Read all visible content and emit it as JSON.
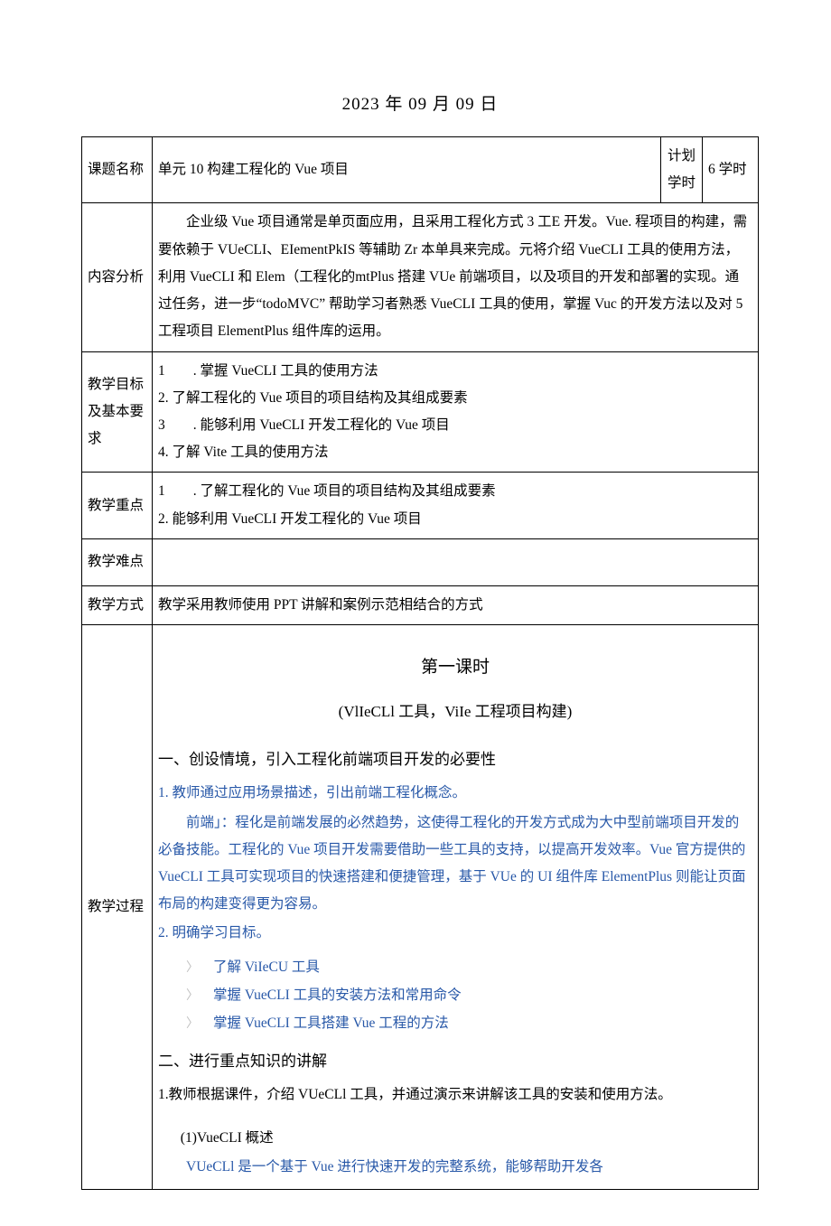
{
  "date": "2023 年 09 月 09 日",
  "rows": {
    "topic_label": "课题名称",
    "topic_value": "单元 10 构建工程化的 Vue 项目",
    "plan_label": "计划学时",
    "plan_value": "6 学时",
    "content_label": "内容分析",
    "content_value": "　　企业级 Vue 项目通常是单页面应用，且采用工程化方式 3 工E 开发。Vue. 程项目的构建，需要依赖于 VUeCLI、EIementPkIS 等辅助 Zr 本单具来完成。元将介绍 VueCLI 工具的使用方法，利用 VueCLI 和 Elem（工程化的mtPlus 搭建 VUe 前端项目，以及项目的开发和部署的实现。通过任务，进一步“todoMVC” 帮助学习者熟悉 VueCLI 工具的使用，掌握 Vuc 的开发方法以及对 5 工程项目 ElementPlus 组件库的运用。",
    "goals_label": "教学目标及基本要求",
    "goals": [
      "1　　. 掌握 VueCLI 工具的使用方法",
      "2. 了解工程化的 Vue 项目的项目结构及其组成要素",
      "3　　. 能够利用 VueCLI 开发工程化的 Vue 项目",
      "4. 了解 Vite 工具的使用方法"
    ],
    "focus_label": "教学重点",
    "focus": [
      "1　　. 了解工程化的 Vue 项目的项目结构及其组成要素",
      "2. 能够利用 VueCLI 开发工程化的 Vue 项目"
    ],
    "difficulty_label": "教学难点",
    "difficulty_value": "",
    "method_label": "教学方式",
    "method_value": "教学采用教师使用 PPT 讲解和案例示范相结合的方式",
    "process_label": "教学过程"
  },
  "process": {
    "lesson_title": "第一课时",
    "lesson_subtitle": "(VlIeCLl 工具，ViIe 工程项目构建)",
    "sec1_title": "一、创设情境，引入工程化前端项目开发的必要性",
    "sec1_item1": "1. 教师通过应用场景描述，引出前端工程化概念。",
    "sec1_para": "前端」：程化是前端发展的必然趋势，这使得工程化的开发方式成为大中型前端项目开发的必备技能。工程化的 Vue 项目开发需要借助一些工具的支持，以提高开发效率。Vue 官方提供的 VueCLI 工具可实现项目的快速搭建和便捷管理，基于 VUe 的 UI 组件库 ElementPlus 则能让页面布局的构建变得更为容易。",
    "sec1_item2": "2. 明确学习目标。",
    "bullets": [
      "了解 ViIeCU 工具",
      "掌握 VueCLI 工具的安装方法和常用命令",
      "掌握 VueCLI 工具搭建 Vue 工程的方法"
    ],
    "sec2_title": "二、进行重点知识的讲解",
    "sec2_item1": "1.教师根据课件，介绍 VUeCLl 工具，并通过演示来讲解该工具的安装和使用方法。",
    "sec2_sub1": "(1)VueCLI 概述",
    "sec2_sub1_para": "VUeCLl 是一个基于 Vue 进行快速开发的完整系统，能够帮助开发各"
  }
}
